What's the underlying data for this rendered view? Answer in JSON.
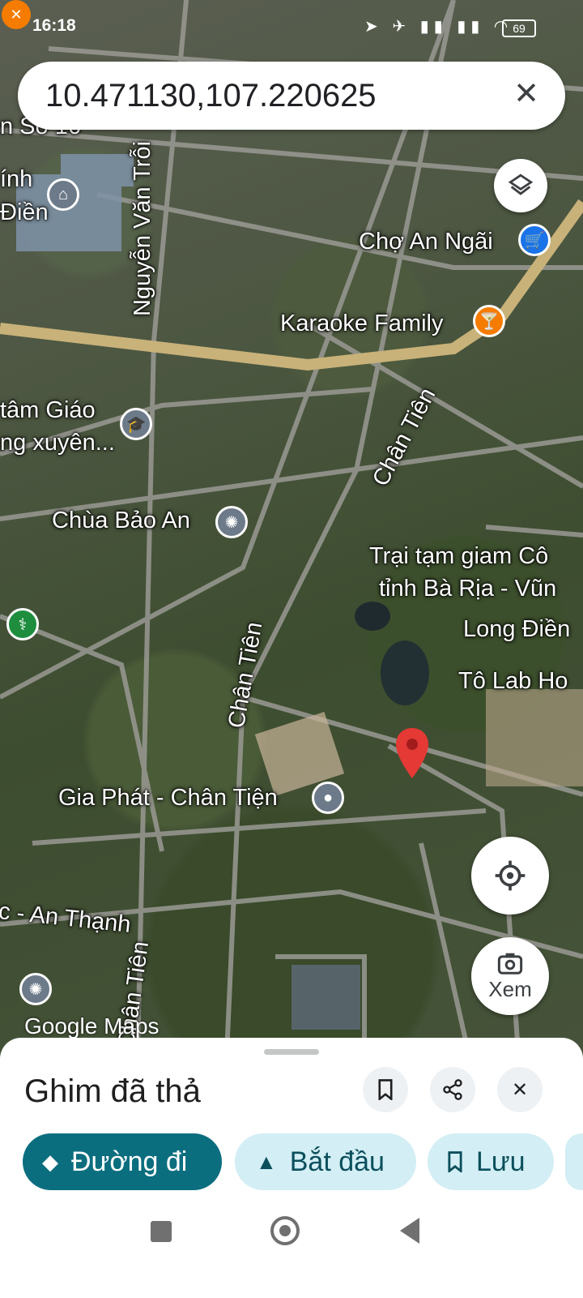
{
  "status_bar": {
    "time": "16:18",
    "battery": "69"
  },
  "search": {
    "query": "10.471130,107.220625",
    "clear_icon": "close-icon"
  },
  "map": {
    "labels": {
      "road_so16": "n Số 16",
      "chinh": "ính",
      "dien": "Điền",
      "nguyen_van_troi": "Nguyễn Văn Trỗi",
      "cho_an_ngai": "Chợ An Ngãi",
      "karaoke_family": "Karaoke Family",
      "tam_giao": "tâm Giáo",
      "ng_xuyen": "ng xuyên...",
      "chan_tien_top": "Chân Tiên",
      "chua_bao_an": "Chùa Bảo An",
      "trai_tam_giam_1": "Trại tạm giam Cô",
      "trai_tam_giam_2": "tỉnh Bà Rịa - Vũn",
      "long_dien": "Long Điền",
      "to_lab": "Tô Lab Ho",
      "chan_tien_mid": "Chân Tiên",
      "gia_phat": "Gia Phát - Chân Tiện",
      "an_thanh": "c - An Thạnh",
      "chan_tien_bottom": "Chân Tiên"
    },
    "watermark": "Google Maps",
    "colors": {
      "main_road": "#c8b27a",
      "minor_road": "#9a9a94",
      "pin": "#e53935"
    }
  },
  "controls": {
    "layers_icon": "layers-icon",
    "locate_icon": "my-location-icon",
    "view_label": "Xem"
  },
  "sheet": {
    "title": "Ghim đã thả",
    "actions": {
      "directions": "Đường đi",
      "start": "Bắt đầu",
      "save": "Lưu"
    },
    "colors": {
      "primary": "#0b6e7f",
      "chip_bg": "#d3eef5"
    }
  }
}
